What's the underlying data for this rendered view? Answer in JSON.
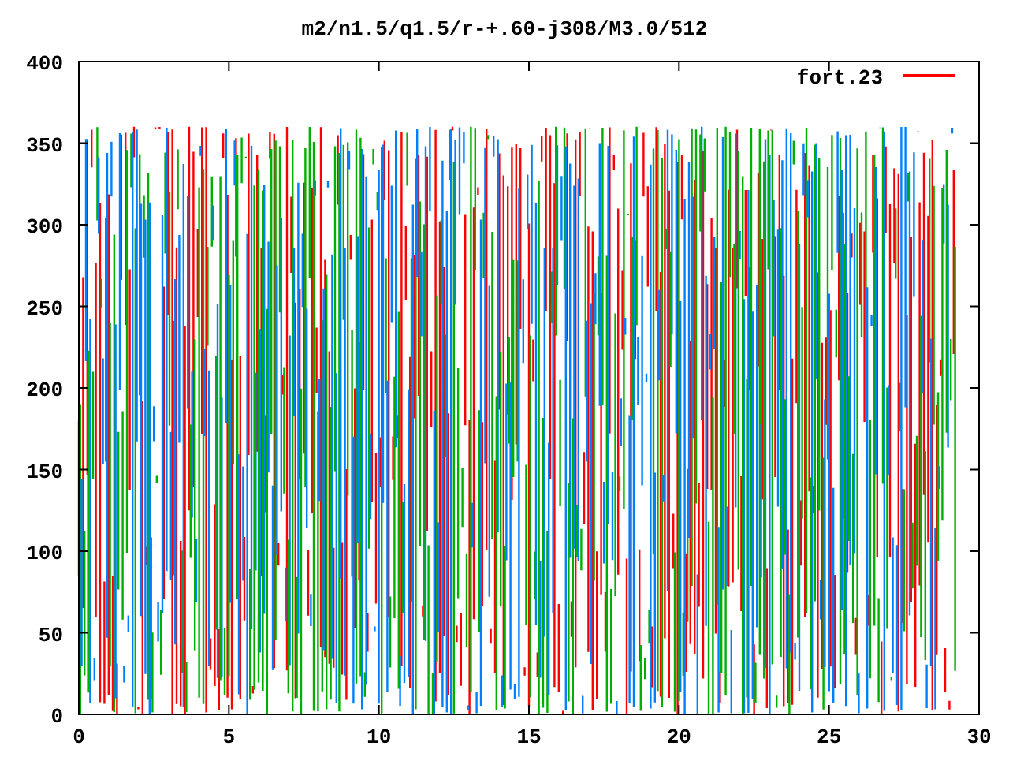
{
  "plot": {
    "title": "m2/n1.5/q1.5/r-+.60-j308/M3.0/512",
    "y_ticks": [
      "400",
      "350",
      "300",
      "250",
      "200",
      "150",
      "100",
      "50",
      "0"
    ],
    "x_ticks": [
      "0",
      "5",
      "10",
      "15",
      "20",
      "25",
      "30"
    ],
    "legend": {
      "label": "fort.23",
      "color": "#ff0000"
    }
  }
}
